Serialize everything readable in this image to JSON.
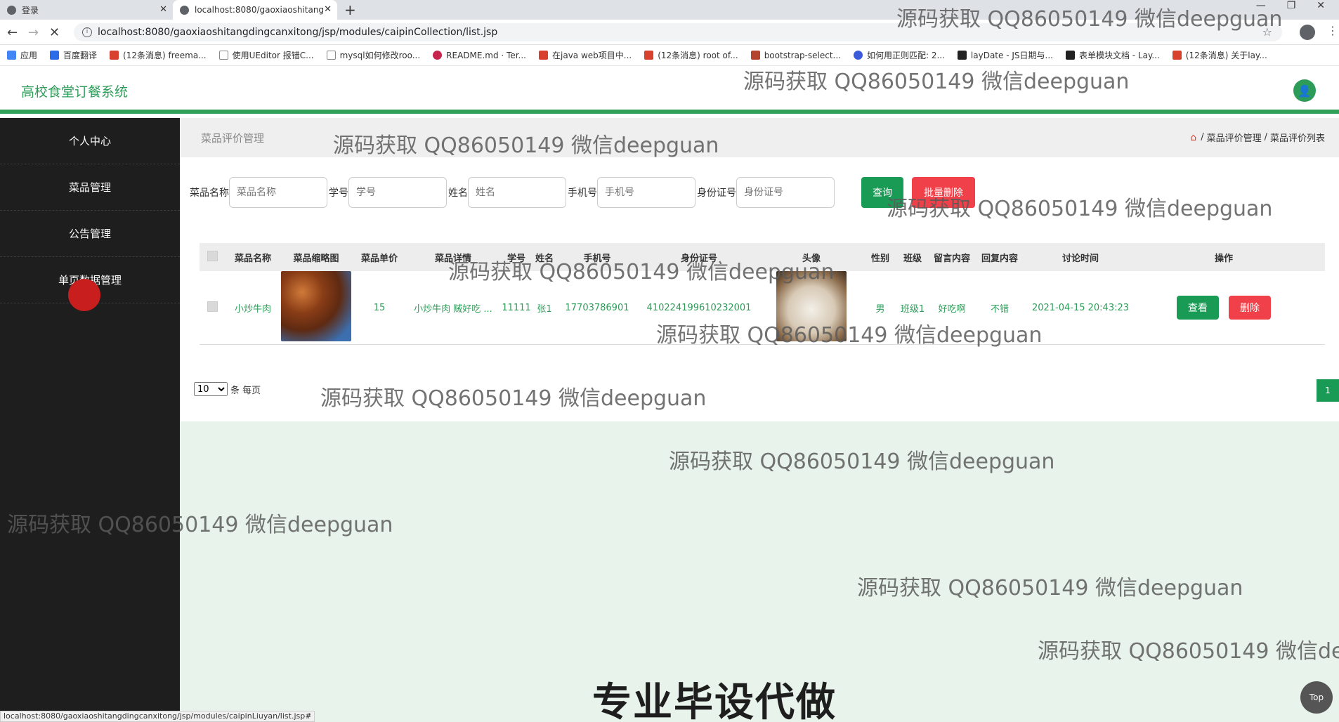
{
  "browser": {
    "tabs": [
      {
        "label": "登录"
      },
      {
        "label": "localhost:8080/gaoxiaoshitang"
      }
    ],
    "url": "localhost:8080/gaoxiaoshitangdingcanxitong/jsp/modules/caipinCollection/list.jsp",
    "bookmarks": [
      "应用",
      "百度翻译",
      "(12条消息) freema...",
      "使用UEditor 报错C...",
      "mysql如何修改roo...",
      "README.md · Ter...",
      "在java web项目中...",
      "(12条消息) root of...",
      "bootstrap-select...",
      "如何用正则匹配: 2...",
      "layDate - JS日期与...",
      "表单模块文档 - Lay...",
      "(12条消息) 关于lay..."
    ],
    "status_url": "localhost:8080/gaoxiaoshitangdingcanxitong/jsp/modules/caipinLiuyan/list.jsp#"
  },
  "app": {
    "title": "高校食堂订餐系统"
  },
  "sidebar": {
    "items": [
      "个人中心",
      "菜品管理",
      "公告管理",
      "单页数据管理"
    ]
  },
  "breadcrumb": {
    "title": "菜品评价管理",
    "path": [
      "菜品评价管理",
      "菜品评价列表"
    ]
  },
  "search": {
    "fields": [
      {
        "label": "菜品名称",
        "placeholder": "菜品名称"
      },
      {
        "label": "学号",
        "placeholder": "学号"
      },
      {
        "label": "姓名",
        "placeholder": "姓名"
      },
      {
        "label": "手机号",
        "placeholder": "手机号"
      },
      {
        "label": "身份证号",
        "placeholder": "身份证号"
      }
    ],
    "query_label": "查询",
    "batch_delete_label": "批量删除"
  },
  "table": {
    "headers": [
      "菜品名称",
      "菜品缩略图",
      "菜品单价",
      "菜品详情",
      "学号",
      "姓名",
      "手机号",
      "身份证号",
      "头像",
      "性别",
      "班级",
      "留言内容",
      "回复内容",
      "讨论时间",
      "操作"
    ],
    "rows": [
      {
        "name": "小炒牛肉",
        "price": "15",
        "detail": "小炒牛肉 贼好吃 ...",
        "student_no": "11111",
        "student_name": "张1",
        "phone": "17703786901",
        "id_no": "410224199610232001",
        "gender": "男",
        "class": "班级1",
        "message": "好吃啊",
        "reply": "不错",
        "time": "2021-04-15 20:43:23",
        "view_label": "查看",
        "delete_label": "删除"
      }
    ]
  },
  "pager": {
    "page_size": "10",
    "per_page_label": "条 每页",
    "current_page": "1"
  },
  "overlay": {
    "watermark": "源码获取 QQ86050149 微信deepguan",
    "big_text": "专业毕设代做",
    "top_button": "Top"
  },
  "colors": {
    "accent": "#2e9c59",
    "danger": "#f0414a",
    "sidebar": "#1e1e1e"
  }
}
